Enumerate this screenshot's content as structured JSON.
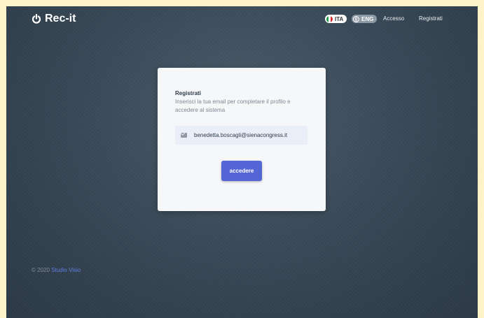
{
  "header": {
    "brand": "Rec-it",
    "languages": [
      {
        "code": "ITA",
        "active": true
      },
      {
        "code": "ENG",
        "active": false
      }
    ],
    "nav": [
      {
        "label": "Accesso"
      },
      {
        "label": "Registrati"
      }
    ]
  },
  "card": {
    "title": "Registrati",
    "description": "Inserisci la tua email per completare il profilo e accedere al sistema",
    "email_value": "benedetta.boscagli@sienacongress.it",
    "submit_label": "accedere"
  },
  "footer": {
    "copyright": "© 2020",
    "brand_link": "Studio Visio"
  },
  "colors": {
    "accent": "#5465d6",
    "background": "#3a4a58",
    "card": "#f6f7f9",
    "link": "#5f7de0"
  }
}
